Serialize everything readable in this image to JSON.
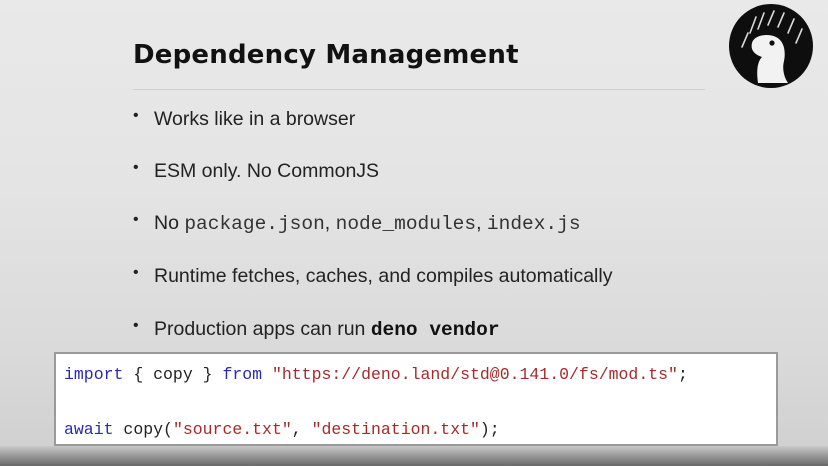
{
  "slide": {
    "title": "Dependency Management",
    "bullets": {
      "b1": "Works like in a browser",
      "b2": "ESM only. No CommonJS",
      "b3_prefix": "No ",
      "b3_code1": "package.json",
      "b3_sep1": ", ",
      "b3_code2": "node_modules",
      "b3_sep2": ", ",
      "b3_code3": "index.js",
      "b4": "Runtime fetches, caches, and compiles automatically",
      "b5_prefix": "Production apps can run ",
      "b5_code": "deno vendor"
    },
    "bullet_marker": "•"
  },
  "code": {
    "line1": {
      "kw_import": "import",
      "mid": " { copy } ",
      "kw_from": "from",
      "space": " ",
      "url": "\"https://deno.land/std@0.141.0/fs/mod.ts\"",
      "end": ";"
    },
    "line2": {
      "kw_await": "await",
      "call": " copy(",
      "arg1": "\"source.txt\"",
      "comma": ", ",
      "arg2": "\"destination.txt\"",
      "end": ");"
    }
  },
  "colors": {
    "keyword": "#2a2ab0",
    "string": "#a52a2a"
  },
  "logo": {
    "icon": "deno-dinosaur-icon"
  }
}
